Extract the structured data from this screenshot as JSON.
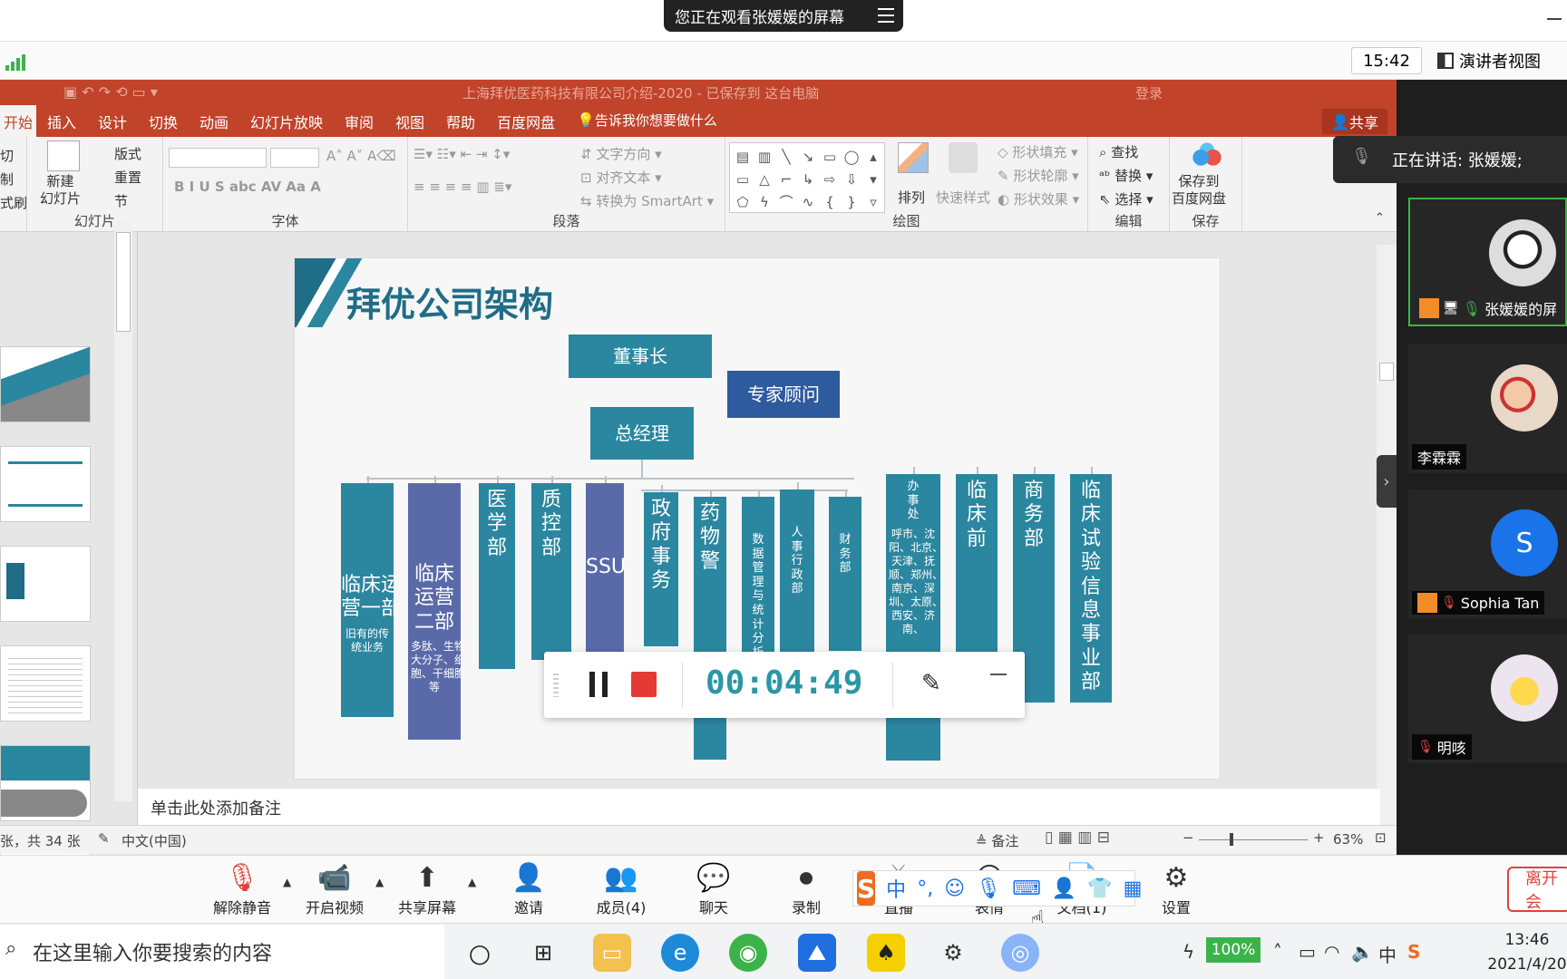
{
  "banner": {
    "text": "您正在观看张媛媛的屏幕"
  },
  "zoom_top": {
    "time": "15:42",
    "speaker_view": "演讲者视图",
    "speaking": "正在讲话: 张媛媛;"
  },
  "ppt": {
    "title": "上海拜优医药科技有限公司介绍-2020 - 已保存到 这台电脑",
    "login": "登录",
    "tabs": [
      "开始",
      "插入",
      "设计",
      "切换",
      "动画",
      "幻灯片放映",
      "审阅",
      "视图",
      "帮助",
      "百度网盘"
    ],
    "tellme": "告诉我你想要做什么",
    "share": "共享",
    "ribbon": {
      "clipboard": [
        "切",
        "制",
        "式刷"
      ],
      "new_slide": "新建\n幻灯片",
      "layout": "版式",
      "reset": "重置",
      "section": "节",
      "slides_group": "幻灯片",
      "font_group": "字体",
      "paragraph_group": "段落",
      "drawing_group": "绘图",
      "edit_group": "编辑",
      "save_group": "保存",
      "text_dir": "文字方向",
      "align_text": "对齐文本",
      "smartart": "转换为 SmartArt",
      "arrange": "排列",
      "quick_style": "快速样式",
      "fill": "形状填充",
      "outline": "形状轮廓",
      "effect": "形状效果",
      "find": "查找",
      "replace": "替换",
      "select": "选择",
      "save_baidu": "保存到\n百度网盘"
    },
    "slide": {
      "title": "拜优公司架构",
      "chairman": "董事长",
      "advisor": "专家顾问",
      "gm": "总经理",
      "departments": [
        {
          "name": "临床运\n营一部",
          "sub": "旧有的传\n统业务"
        },
        {
          "name": "临床\n运营\n二部",
          "sub": "多肽、生物\n大分子、细\n胞、干细胞\n等"
        },
        {
          "name": "医\n学\n部"
        },
        {
          "name": "质\n控\n部"
        },
        {
          "name": "SSU"
        },
        {
          "name": "政\n府\n事\n务"
        },
        {
          "name": "药\n物\n警"
        },
        {
          "name": "数\n据\n管\n理\n与\n统\n计\n分\n析"
        },
        {
          "name": "人\n事\n行\n政\n部"
        },
        {
          "name": "财\n务\n部"
        },
        {
          "name": "办\n事\n处",
          "sub": "呼市、沈\n阳、北京、\n天津、抚\n顺、郑州、\n南京、深\n圳、太原、\n西安、济\n南、"
        },
        {
          "name": "临\n床\n前"
        },
        {
          "name": "商\n务\n部"
        },
        {
          "name": "临\n床\n试\n验\n信\n息\n事\n业\n部"
        }
      ]
    },
    "notes": "单击此处添加备注",
    "status": {
      "slides": "张，共 34 张",
      "lang": "中文(中国)",
      "notes_btn": "备注",
      "zoom": "63%"
    }
  },
  "recorder": {
    "time": "00:04:49"
  },
  "participants": [
    {
      "name": "张媛媛的屏"
    },
    {
      "name": "李霖霖"
    },
    {
      "name": "Sophia Tan",
      "initial": "S"
    },
    {
      "name": "明咳"
    }
  ],
  "toolbar": {
    "mute": "解除静音",
    "video": "开启视频",
    "share": "共享屏幕",
    "invite": "邀请",
    "members": "成员(4)",
    "chat": "聊天",
    "record": "录制",
    "live": "直播",
    "react": "表情",
    "docs": "文档(1)",
    "settings": "设置",
    "leave": "离开会"
  },
  "ime": {
    "lang": "中"
  },
  "taskbar": {
    "search": "在这里输入你要搜索的内容",
    "battery": "100%",
    "tray_lang": "中",
    "time": "13:46",
    "date": "2021/4/20"
  }
}
